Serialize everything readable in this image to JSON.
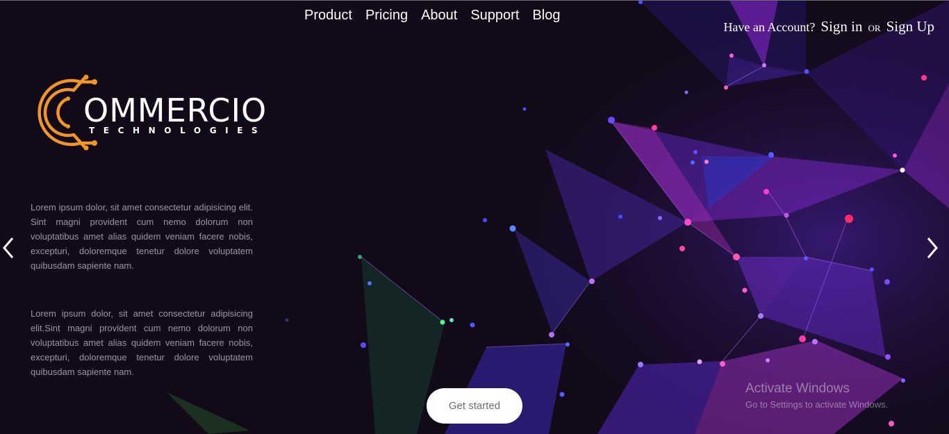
{
  "nav": {
    "items": [
      "Product",
      "Pricing",
      "About",
      "Support",
      "Blog"
    ]
  },
  "account": {
    "prompt": "Have an Account?",
    "sign_in": "Sign in",
    "or": "OR",
    "sign_up": "Sign Up"
  },
  "logo": {
    "word": "OMMERCIO",
    "sub": "TECHNOLOGIES",
    "color": "#f0952a"
  },
  "hero": {
    "paragraph_1": "Lorem ipsum dolor, sit amet consectetur adipisicing elit. Sint magni provident cum nemo dolorum non voluptatibus amet alias quidem veniam facere nobis, excepturi, doloremque tenetur dolore voluptatem quibusdam sapiente nam.",
    "paragraph_2": "Lorem ipsum dolor, sit amet consectetur adipisicing elit.Sint magni provident cum nemo dolorum non voluptatibus amet alias quidem veniam facere nobis, excepturi, doloremque tenetur dolore voluptatem quibusdam sapiente nam.",
    "cta_label": "Get started"
  },
  "carousel": {
    "prev_icon": "chevron-left-icon",
    "next_icon": "chevron-right-icon"
  },
  "watermark": {
    "title": "Activate Windows",
    "subtitle": "Go to Settings to activate Windows."
  },
  "colors": {
    "background": "#0f0915",
    "accent_purple": "#7b2ff0",
    "accent_magenta": "#e0209a",
    "accent_orange": "#f0952a"
  }
}
